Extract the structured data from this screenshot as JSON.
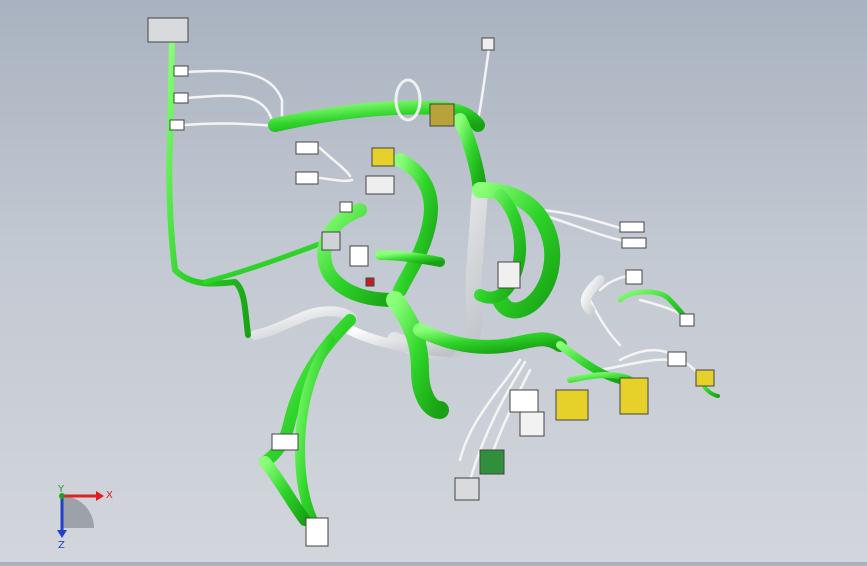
{
  "viewport": {
    "background_top": "#a9b2c0",
    "background_bottom": "#d2d6dc"
  },
  "model": {
    "harness_color": "#33d92e",
    "harness_edge": "#1d8f18",
    "wire_color": "#ffffff",
    "connector_yellow": "#e6d12a",
    "connector_olive": "#b8a23a",
    "connector_green": "#2f8f3a",
    "connector_gray": "#9aa0a8"
  },
  "triad": {
    "x_label": "X",
    "y_label": "Y",
    "z_label": "Z",
    "x_color": "#e02020",
    "y_color": "#20a020",
    "z_color": "#2040d0"
  }
}
